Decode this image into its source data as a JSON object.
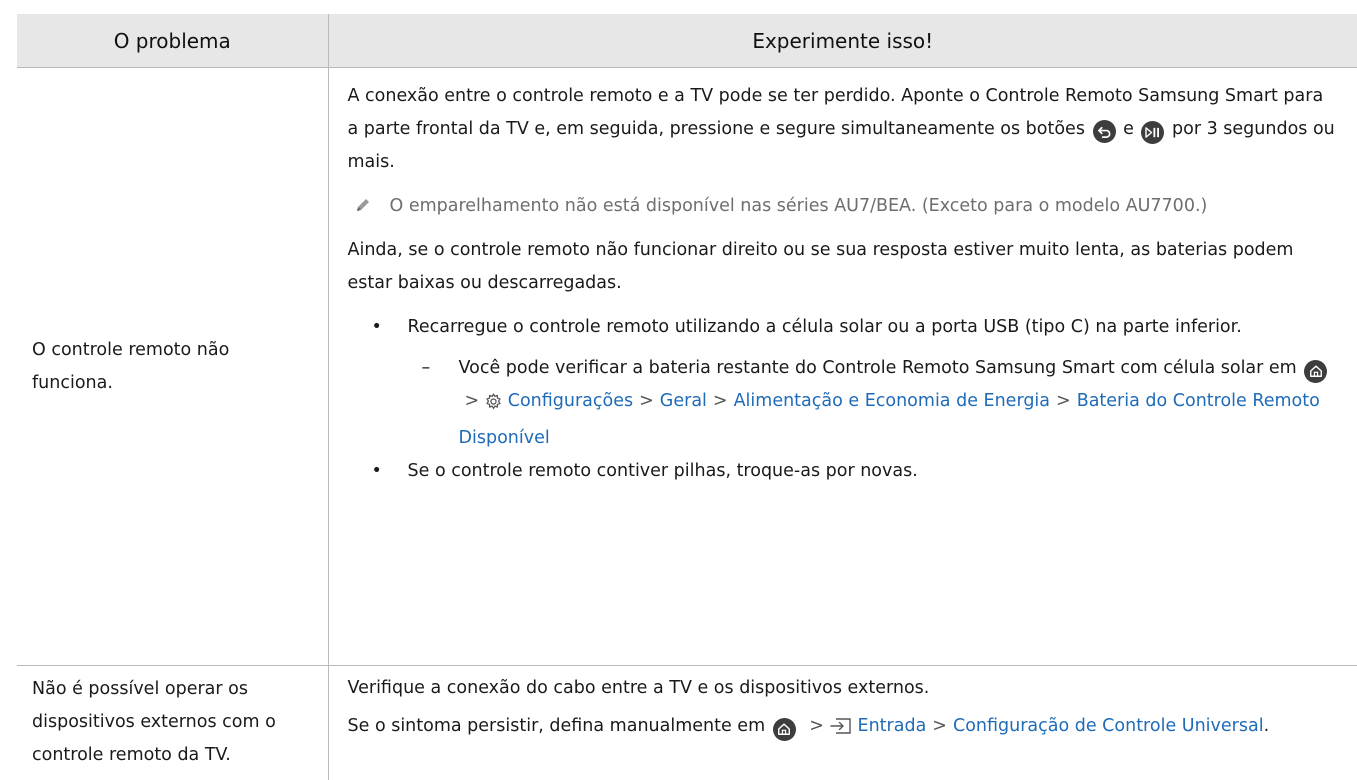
{
  "header": {
    "col1": "O problema",
    "col2": "Experimente isso!"
  },
  "rows": [
    {
      "problem": "O controle remoto não funciona.",
      "p1_a": "A conexão entre o controle remoto e a TV pode se ter perdido. Aponte o Controle Remoto Samsung Smart para a parte frontal da TV e, em seguida, pressione e segure simultaneamente os botões",
      "p1_and": "e",
      "p1_b": "por 3 segundos ou mais.",
      "note": "O emparelhamento não está disponível nas séries AU7/BEA. (Exceto para o modelo AU7700.)",
      "p2": "Ainda, se o controle remoto não funcionar direito ou se sua resposta estiver muito lenta, as baterias podem estar baixas ou descarregadas.",
      "bullet1": "Recarregue o controle remoto utilizando a célula solar ou a porta USB (tipo C) na parte inferior.",
      "sub1_text": "Você pode verificar a bateria restante do Controle Remoto Samsung Smart com célula solar em",
      "sub1_path": [
        "Configurações",
        "Geral",
        "Alimentação e Economia de Energia",
        "Bateria do Controle Remoto Disponível"
      ],
      "bullet2": "Se o controle remoto contiver pilhas, troque-as por novas."
    },
    {
      "problem": "Não é possível operar os dispositivos externos com o controle remoto da TV.",
      "p1": "Verifique a conexão do cabo entre a TV e os dispositivos externos.",
      "p2_text": "Se o sintoma persistir, defina manualmente em",
      "p2_path": [
        "Entrada",
        "Configuração de Controle Universal"
      ],
      "p2_end": "."
    }
  ],
  "icons": {
    "back": "back-button-icon",
    "playpause": "play-pause-button-icon",
    "home": "home-icon",
    "settings": "gear-icon",
    "source": "source-input-icon",
    "note": "pencil-note-icon"
  },
  "colors": {
    "link": "#1f6bb8",
    "header_bg": "#e7e7e7",
    "border": "#b9b9b9",
    "note_text": "#6e6e6e"
  }
}
